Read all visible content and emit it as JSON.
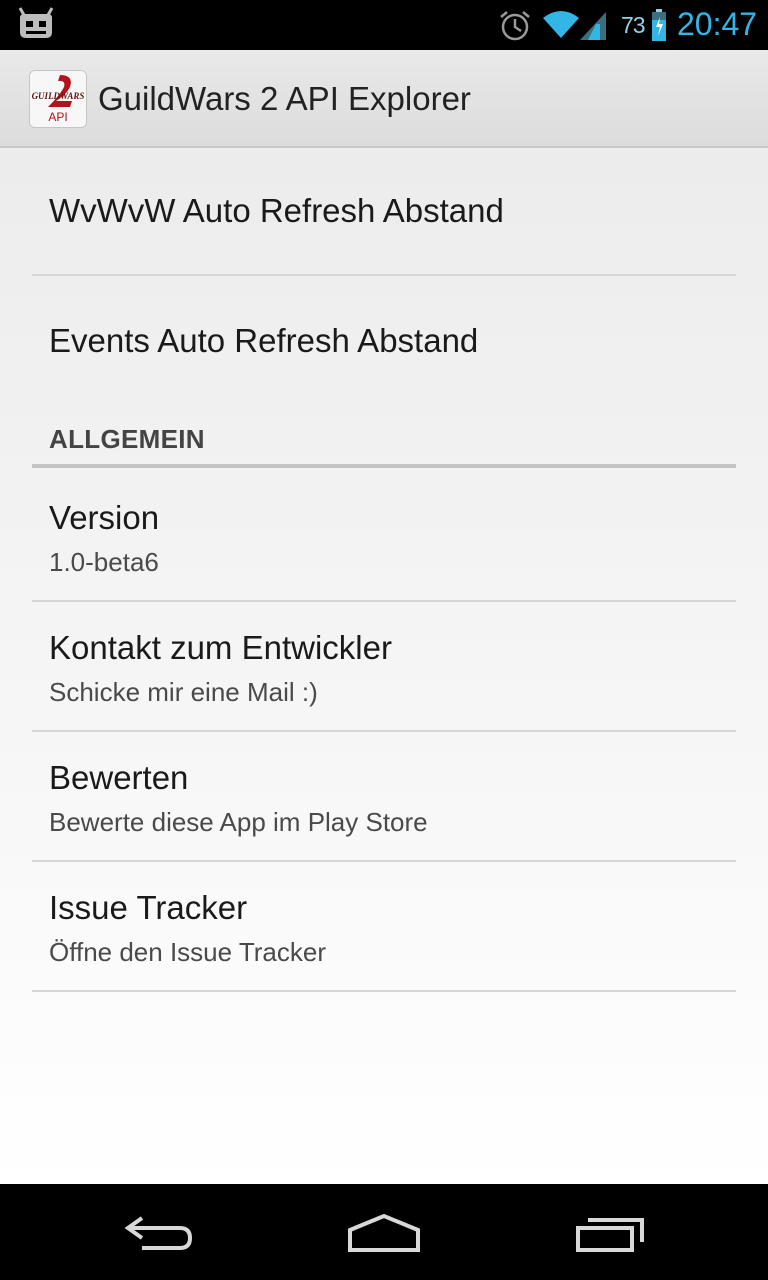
{
  "status_bar": {
    "battery_percent": "73",
    "time": "20:47"
  },
  "action_bar": {
    "title": "GuildWars 2 API Explorer",
    "icon_caption": "API"
  },
  "preferences": {
    "wvw_refresh": {
      "title": "WvWvW Auto Refresh Abstand"
    },
    "events_refresh": {
      "title": "Events Auto Refresh Abstand"
    },
    "category_general": "ALLGEMEIN",
    "version": {
      "title": "Version",
      "summary": "1.0-beta6"
    },
    "contact": {
      "title": "Kontakt zum Entwickler",
      "summary": "Schicke mir eine Mail :)"
    },
    "rate": {
      "title": "Bewerten",
      "summary": "Bewerte diese App im Play Store"
    },
    "issue_tracker": {
      "title": "Issue Tracker",
      "summary": "Öffne den Issue Tracker"
    }
  },
  "nav_bar": {
    "back": "back-icon",
    "home": "home-icon",
    "recents": "recents-icon"
  },
  "colors": {
    "clock": "#33b5e5",
    "action_bar": "#e3e3e3",
    "category_text": "#444444"
  }
}
